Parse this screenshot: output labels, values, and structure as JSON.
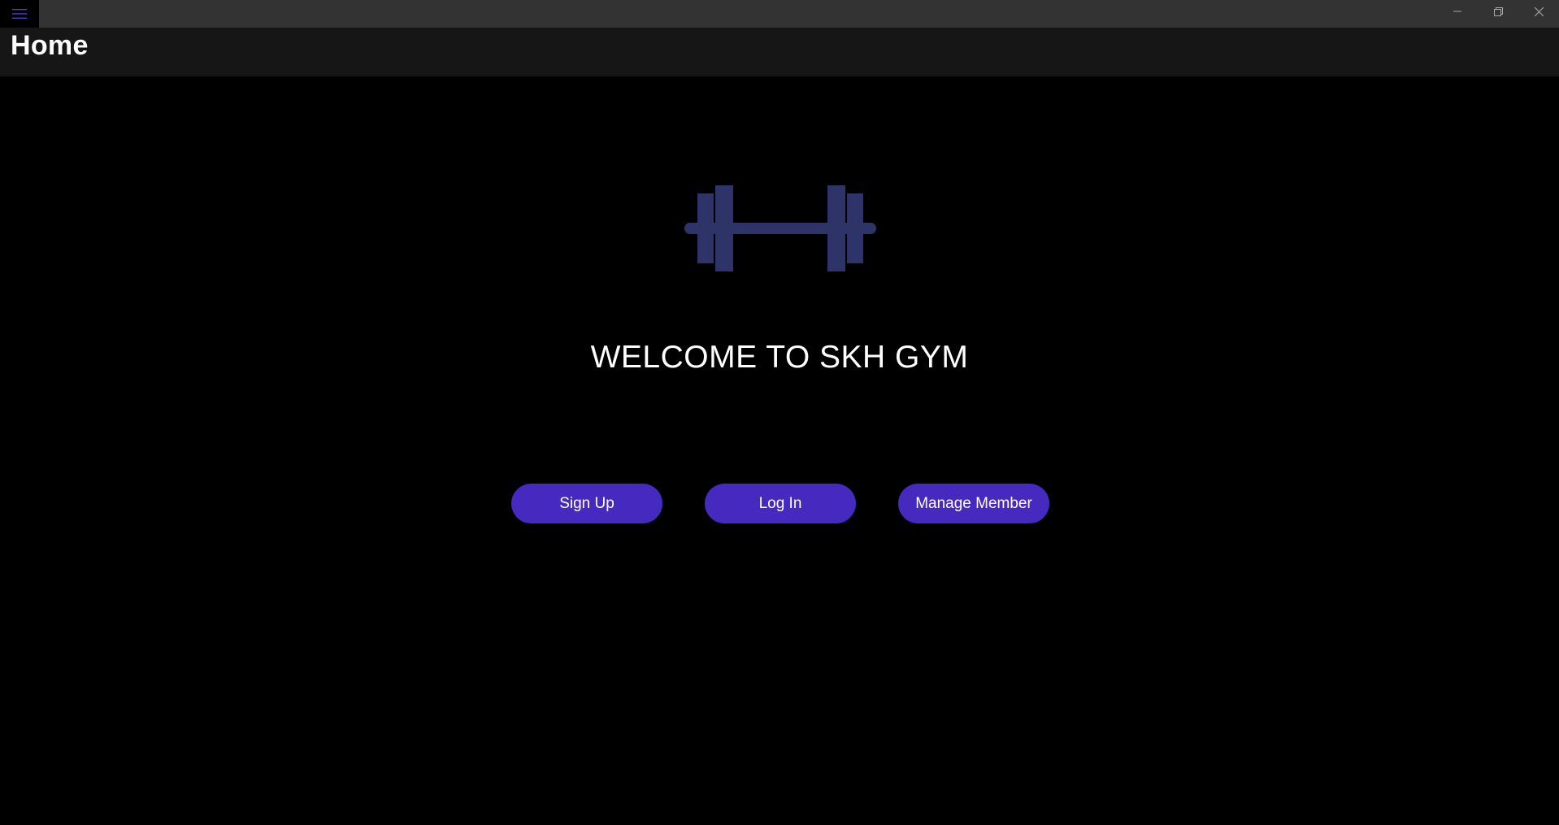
{
  "window": {
    "menu_icon": "hamburger-menu-icon",
    "controls": [
      "minimize-icon",
      "restore-icon",
      "close-icon"
    ]
  },
  "header": {
    "title": "Home"
  },
  "main": {
    "logo_icon": "barbell-icon",
    "welcome_text": "WELCOME TO SKH GYM",
    "buttons": {
      "signup": "Sign Up",
      "login": "Log In",
      "manage": "Manage Member"
    }
  },
  "colors": {
    "accent": "#4629bf",
    "logo": "#2e3468",
    "background": "#000000",
    "titlebar": "#333333",
    "header": "#161616"
  }
}
